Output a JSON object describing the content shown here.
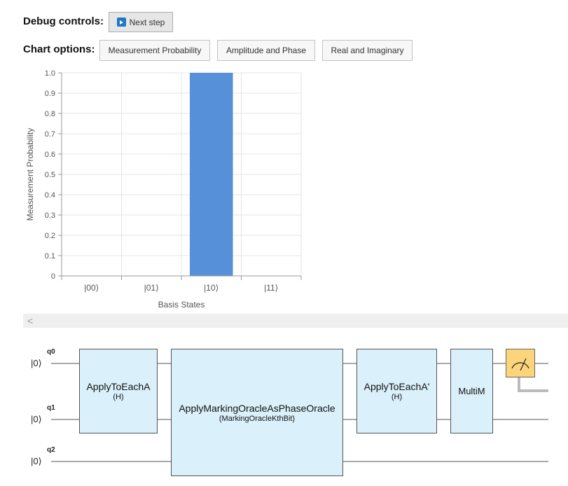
{
  "debug": {
    "label": "Debug controls:",
    "next_step": "Next step"
  },
  "chart_options": {
    "label": "Chart options:",
    "buttons": [
      "Measurement Probability",
      "Amplitude and Phase",
      "Real and Imaginary"
    ]
  },
  "chart_data": {
    "type": "bar",
    "categories": [
      "|00⟩",
      "|01⟩",
      "|10⟩",
      "|11⟩"
    ],
    "values": [
      0,
      0,
      1.0,
      0
    ],
    "xlabel": "Basis States",
    "ylabel": "Measurement Probability",
    "ylim": [
      0,
      1.0
    ],
    "yticks": [
      "0",
      "0.1",
      "0.2",
      "0.3",
      "0.4",
      "0.5",
      "0.6",
      "0.7",
      "0.8",
      "0.9",
      "1.0"
    ],
    "grid": true,
    "color": "#5590d9"
  },
  "scrollbar": {
    "arrow": "<"
  },
  "circuit": {
    "qubits": [
      {
        "name": "q0",
        "state": "|0⟩"
      },
      {
        "name": "q1",
        "state": "|0⟩"
      },
      {
        "name": "q2",
        "state": "|0⟩"
      }
    ],
    "gates": [
      {
        "name": "ApplyToEachA",
        "arg": "(H)"
      },
      {
        "name": "ApplyMarkingOracleAsPhaseOracle",
        "arg": "(MarkingOracleKthBit)"
      },
      {
        "name": "ApplyToEachA'",
        "arg": "(H)"
      },
      {
        "name": "MultiM",
        "arg": ""
      }
    ],
    "gate_color": "#daf0fa",
    "measure_color": "#fbd47c"
  }
}
